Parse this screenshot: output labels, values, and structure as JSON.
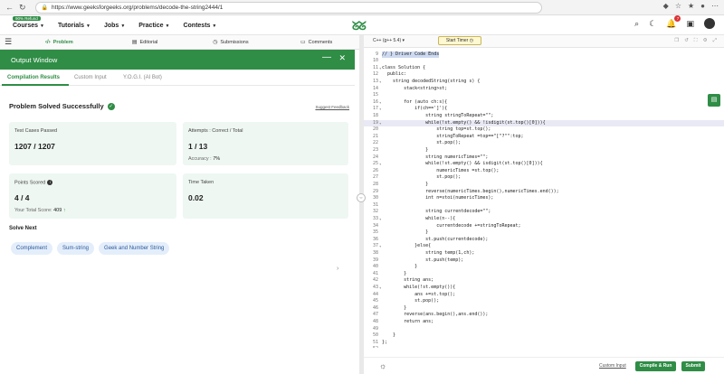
{
  "browser": {
    "url": "https://www.geeksforgeeks.org/problems/decode-the-string2444/1",
    "lock_icon": "lock-icon"
  },
  "nav": {
    "refund_badge": "90% Refund",
    "items": [
      {
        "label": "Courses"
      },
      {
        "label": "Tutorials"
      },
      {
        "label": "Jobs"
      },
      {
        "label": "Practice"
      },
      {
        "label": "Contests"
      }
    ],
    "logo": "GG",
    "notification_count": "7"
  },
  "left_tabs": [
    {
      "label": "Problem"
    },
    {
      "label": "Editorial"
    },
    {
      "label": "Submissions"
    },
    {
      "label": "Comments"
    }
  ],
  "output": {
    "title": "Output Window",
    "subtabs": [
      {
        "label": "Compilation Results"
      },
      {
        "label": "Custom Input"
      },
      {
        "label": "Y.O.G.I. (AI Bot)"
      }
    ],
    "status": "Problem Solved Successfully",
    "suggest_feedback": "Suggest Feedback",
    "cards": {
      "test_cases": {
        "label": "Test Cases Passed",
        "value": "1207 / 1207"
      },
      "attempts": {
        "label": "Attempts : Correct / Total",
        "value": "1 / 13",
        "sub_label": "Accuracy :",
        "sub_value": "7%"
      },
      "points": {
        "label": "Points Scored",
        "value": "4 / 4",
        "sub_label": "Your Total Score:",
        "sub_value": "409"
      },
      "time": {
        "label": "Time Taken",
        "value": "0.02"
      }
    },
    "solve_next_title": "Solve Next",
    "solve_next": [
      "Complement",
      "Sum-string",
      "Geek and Number String"
    ]
  },
  "editor": {
    "language": "C++ (g++ 5.4)",
    "timer_label": "Start Timer",
    "lines": [
      {
        "n": "9",
        "text": "// } Driver Code Ends",
        "hl": true
      },
      {
        "n": "10",
        "text": ""
      },
      {
        "n": "11",
        "text": "class Solution {",
        "fold": true
      },
      {
        "n": "12",
        "text": "  public:"
      },
      {
        "n": "13",
        "text": "    string decodedString(string s) {",
        "fold": true
      },
      {
        "n": "14",
        "text": "        stack<string>st;"
      },
      {
        "n": "15",
        "text": ""
      },
      {
        "n": "16",
        "text": "        for (auto ch:s){",
        "fold": true
      },
      {
        "n": "17",
        "text": "            if(ch==']'){",
        "fold": true
      },
      {
        "n": "18",
        "text": "                string stringToRepeat=\"\";"
      },
      {
        "n": "19",
        "text": "                while(!st.empty() && !isdigit(st.top()[0])){",
        "fold": true,
        "sel": true
      },
      {
        "n": "20",
        "text": "                    string top=st.top();"
      },
      {
        "n": "21",
        "text": "                    stringToRepeat =top==\"[\"?\"\":top;"
      },
      {
        "n": "22",
        "text": "                    st.pop();"
      },
      {
        "n": "23",
        "text": "                }"
      },
      {
        "n": "24",
        "text": "                string numericTimes=\"\";"
      },
      {
        "n": "25",
        "text": "                while(!st.empty() && isdigit(st.top()[0])){",
        "fold": true
      },
      {
        "n": "26",
        "text": "                    numericTimes =st.top();"
      },
      {
        "n": "27",
        "text": "                    st.pop();"
      },
      {
        "n": "28",
        "text": "                }"
      },
      {
        "n": "29",
        "text": "                reverse(numericTimes.begin(),numericTimes.end());"
      },
      {
        "n": "30",
        "text": "                int n=stoi(numericTimes);"
      },
      {
        "n": "31",
        "text": ""
      },
      {
        "n": "32",
        "text": "                string currentdecode=\"\";"
      },
      {
        "n": "33",
        "text": "                while(n--){",
        "fold": true
      },
      {
        "n": "34",
        "text": "                    currentdecode +=stringToRepeat;"
      },
      {
        "n": "35",
        "text": "                }"
      },
      {
        "n": "36",
        "text": "                st.push(currentdecode);"
      },
      {
        "n": "37",
        "text": "            }else{",
        "fold": true
      },
      {
        "n": "38",
        "text": "                string temp(1,ch);"
      },
      {
        "n": "39",
        "text": "                st.push(temp);"
      },
      {
        "n": "40",
        "text": "            }"
      },
      {
        "n": "41",
        "text": "        }"
      },
      {
        "n": "42",
        "text": "        string ans;"
      },
      {
        "n": "43",
        "text": "        while(!st.empty()){",
        "fold": true
      },
      {
        "n": "44",
        "text": "            ans +=st.top();"
      },
      {
        "n": "45",
        "text": "            st.pop();"
      },
      {
        "n": "46",
        "text": "        }"
      },
      {
        "n": "47",
        "text": "        reverse(ans.begin(),ans.end());"
      },
      {
        "n": "48",
        "text": "        return ans;"
      },
      {
        "n": "49",
        "text": ""
      },
      {
        "n": "50",
        "text": "    }"
      },
      {
        "n": "51",
        "text": "};"
      },
      {
        "n": "52",
        "text": ""
      },
      {
        "n": "53",
        "text": "// } Driver Code Ends",
        "hl": true
      }
    ],
    "custom_input": "Custom Input",
    "compile_run": "Compile & Run",
    "submit": "Submit"
  },
  "colors": {
    "brand": "#2f8d46",
    "chip_bg": "#e4eefb"
  }
}
